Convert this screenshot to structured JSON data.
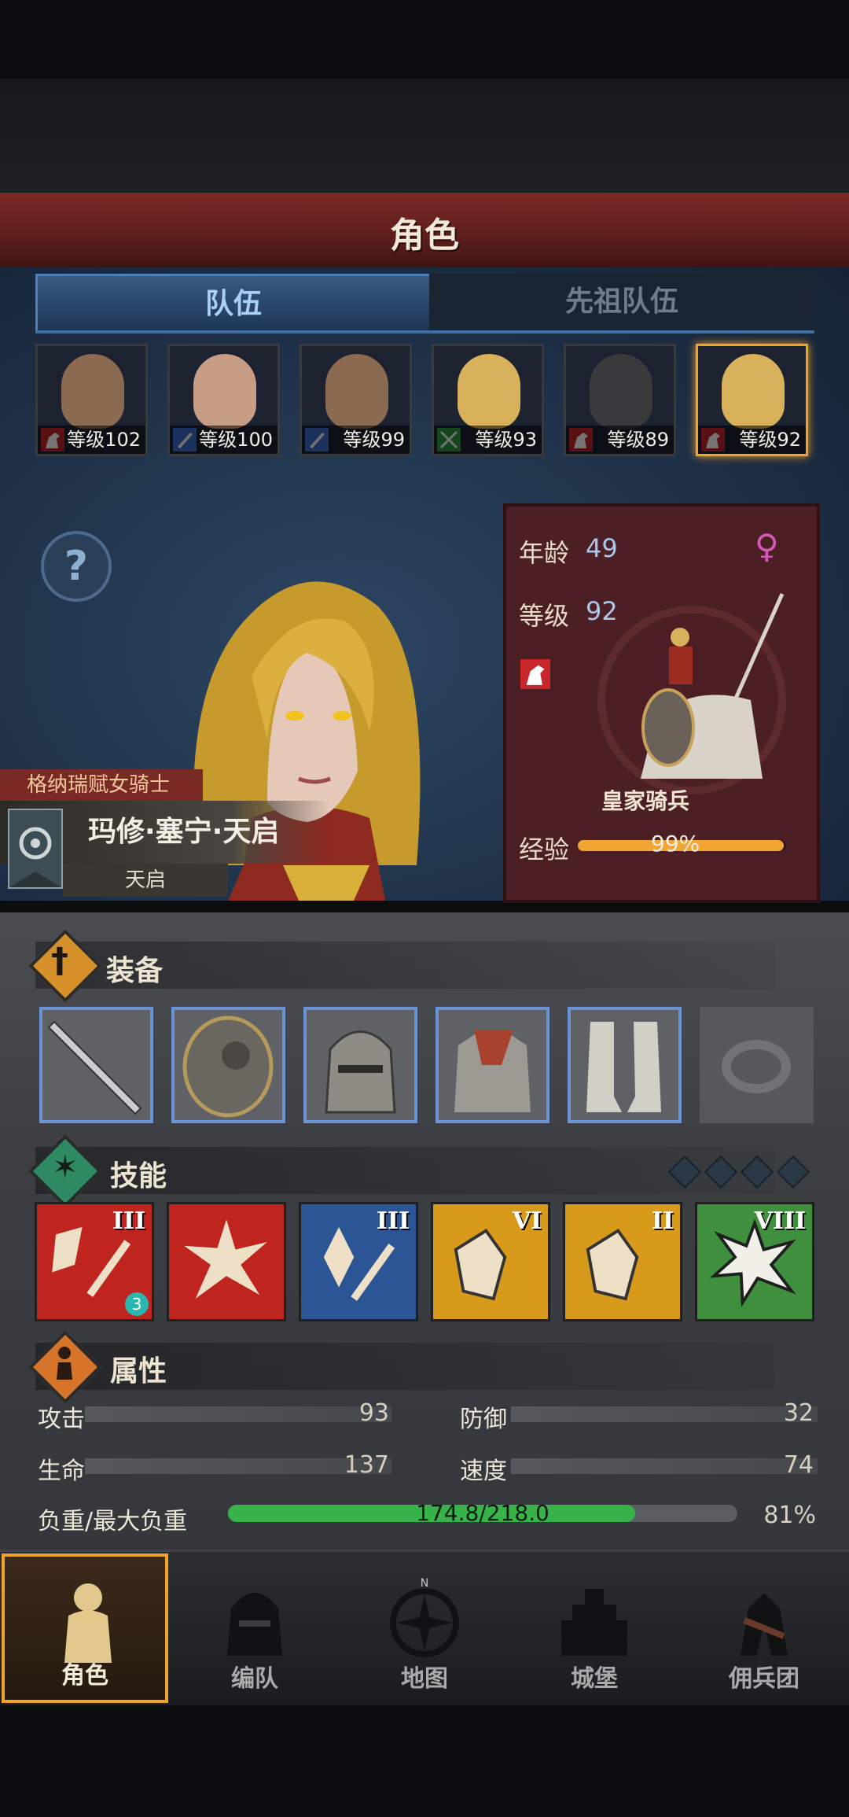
{
  "header": {
    "title": "角色"
  },
  "tabs": [
    {
      "label": "队伍",
      "active": true
    },
    {
      "label": "先祖队伍",
      "active": false
    }
  ],
  "team": [
    {
      "level": "等级102",
      "class_icon": "horse-icon",
      "class_color": "#c8262b"
    },
    {
      "level": "等级100",
      "class_icon": "sword-icon",
      "class_color": "#3c6fd1"
    },
    {
      "level": "等级99",
      "class_icon": "sword-icon",
      "class_color": "#3c6fd1"
    },
    {
      "level": "等级93",
      "class_icon": "bow-icon",
      "class_color": "#2f9a3c"
    },
    {
      "level": "等级89",
      "class_icon": "horse-icon",
      "class_color": "#c8262b"
    },
    {
      "level": "等级92",
      "class_icon": "horse-icon",
      "class_color": "#c8262b",
      "selected": true
    }
  ],
  "help": {
    "symbol": "?"
  },
  "character": {
    "title": "格纳瑞赋女骑士",
    "name": "玛修·塞宁·天启",
    "subtitle": "天启",
    "age_label": "年龄",
    "age": "49",
    "level_label": "等级",
    "level": "92",
    "gender_symbol": "♀",
    "unit_class": "皇家骑兵",
    "exp_label": "经验",
    "exp_percent_text": "99%",
    "exp_fraction": 0.99
  },
  "equipment": {
    "title": "装备",
    "slots": [
      {
        "icon": "sword-icon"
      },
      {
        "icon": "shield-icon"
      },
      {
        "icon": "helmet-icon"
      },
      {
        "icon": "armor-icon"
      },
      {
        "icon": "boots-icon"
      },
      {
        "icon": "ring-icon",
        "empty": true
      }
    ]
  },
  "skills": {
    "title": "技能",
    "items": [
      {
        "rank": "III",
        "color": "#c0241f",
        "icon": "slash-strike-icon",
        "badge": "3"
      },
      {
        "rank": "",
        "color": "#c0241f",
        "icon": "burst-strike-icon"
      },
      {
        "rank": "III",
        "color": "#2c5596",
        "icon": "crystal-blade-icon"
      },
      {
        "rank": "VI",
        "color": "#d89a1a",
        "icon": "shield-break-icon"
      },
      {
        "rank": "II",
        "color": "#d89a1a",
        "icon": "shield-break-icon"
      },
      {
        "rank": "VIII",
        "color": "#3f8f3e",
        "icon": "burst-icon"
      }
    ]
  },
  "attributes": {
    "title": "属性",
    "attack_label": "攻击",
    "attack": "93",
    "defense_label": "防御",
    "defense": "32",
    "hp_label": "生命",
    "hp": "137",
    "speed_label": "速度",
    "speed": "74",
    "load_label": "负重/最大负重",
    "load_text": "174.8/218.0",
    "load_percent": "81%",
    "load_fraction": 0.8
  },
  "nav": [
    {
      "label": "角色",
      "icon": "knight-icon",
      "selected": true
    },
    {
      "label": "编队",
      "icon": "helmet-icon"
    },
    {
      "label": "地图",
      "icon": "compass-icon"
    },
    {
      "label": "城堡",
      "icon": "castle-icon"
    },
    {
      "label": "佣兵团",
      "icon": "mercenary-icon"
    }
  ],
  "compass_letter": "N"
}
